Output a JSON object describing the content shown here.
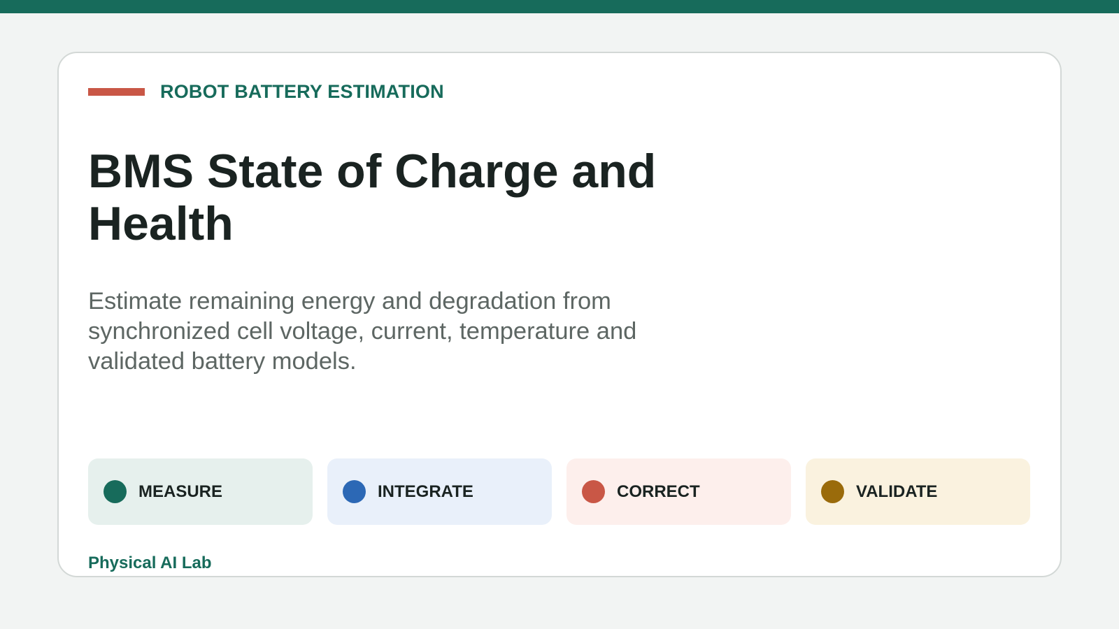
{
  "brand": {
    "primary": "#176b5b",
    "accent": "#c95746"
  },
  "eyebrow": "ROBOT BATTERY ESTIMATION",
  "title": "BMS State of Charge and Health",
  "subtitle": "Estimate remaining energy and degradation from synchronized cell voltage, current, temperature and validated battery models.",
  "steps": [
    {
      "label": "MEASURE",
      "dot_color": "#176b5b",
      "bg_color": "#e6f0ed"
    },
    {
      "label": "INTEGRATE",
      "dot_color": "#2c68b5",
      "bg_color": "#e9f0fa"
    },
    {
      "label": "CORRECT",
      "dot_color": "#c95746",
      "bg_color": "#fdefec"
    },
    {
      "label": "VALIDATE",
      "dot_color": "#9a6b0b",
      "bg_color": "#faf2df"
    }
  ],
  "footer": "Physical AI Lab"
}
